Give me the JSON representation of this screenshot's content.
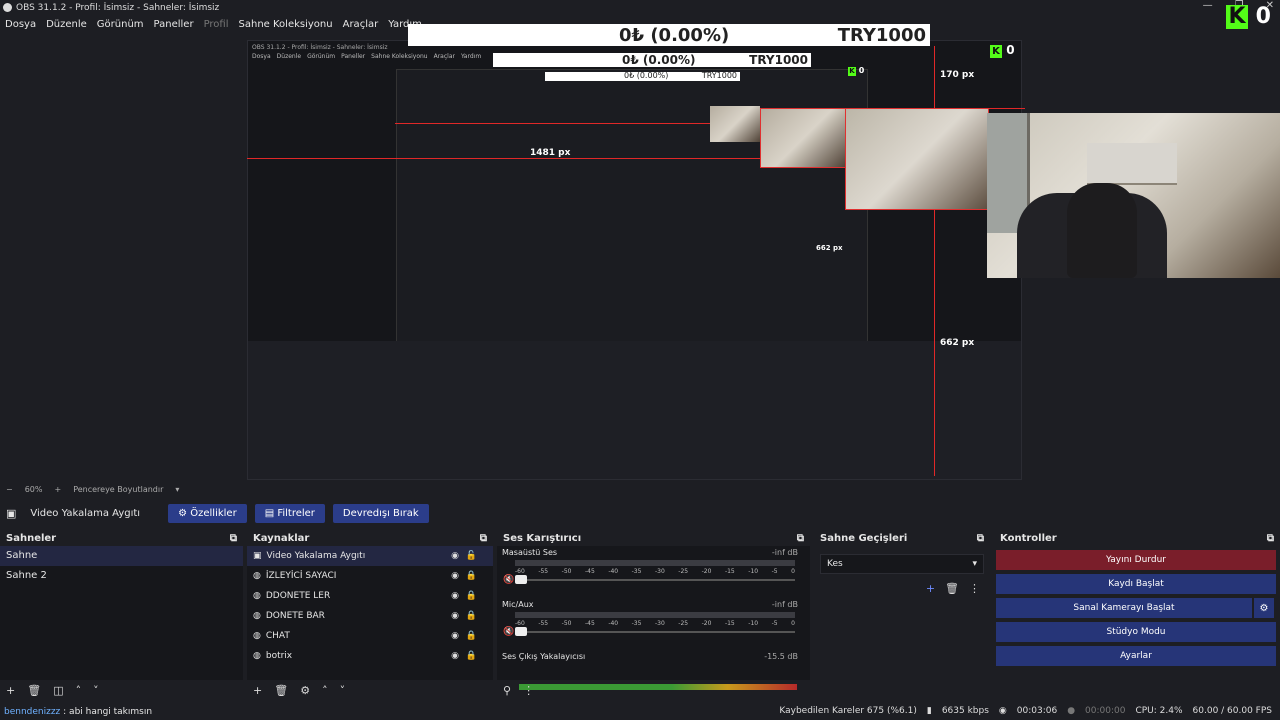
{
  "window": {
    "title": "OBS 31.1.2 - Profil: İsimsiz - Sahneler: İsimsiz",
    "controls": [
      "—",
      "❐",
      "✕"
    ]
  },
  "menu": [
    "Dosya",
    "Düzenle",
    "Görünüm",
    "Paneller",
    "Profil",
    "Sahne Koleksiyonu",
    "Araçlar",
    "Yardım"
  ],
  "overlay": {
    "ticker_left": "0₺ (0.00%)",
    "ticker_right": "TRY1000",
    "kick_count": "0",
    "px_labels": [
      "170 px",
      "1481 px",
      "662 px",
      "662 px"
    ]
  },
  "zoom": {
    "value": "60%",
    "fit_label": "Pencereye Boyutlandır"
  },
  "source_toolbar": {
    "current_source": "Video Yakalama Aygıtı",
    "properties": "Özellikler",
    "filters": "Filtreler",
    "deactivate": "Devredışı Bırak"
  },
  "scenes": {
    "title": "Sahneler",
    "items": [
      "Sahne",
      "Sahne 2"
    ]
  },
  "sources": {
    "title": "Kaynaklar",
    "items": [
      "Video Yakalama Aygıtı",
      "İZLEYİCİ SAYACI",
      "DDONETE LER",
      "DONETE BAR",
      "CHAT",
      "botrix"
    ]
  },
  "mixer": {
    "title": "Ses Karıştırıcı",
    "channels": [
      {
        "name": "Masaüstü Ses",
        "db": "-inf dB"
      },
      {
        "name": "Mic/Aux",
        "db": "-inf dB"
      }
    ],
    "scale": [
      "-60",
      "-55",
      "-50",
      "-45",
      "-40",
      "-35",
      "-30",
      "-25",
      "-20",
      "-15",
      "-10",
      "-5",
      "0"
    ],
    "output": {
      "name": "Ses Çıkış Yakalayıcısı",
      "db": "-15.5 dB"
    }
  },
  "transitions": {
    "title": "Sahne Geçişleri",
    "selected": "Kes"
  },
  "controls": {
    "title": "Kontroller",
    "stop_stream": "Yayını Durdur",
    "start_recording": "Kaydı Başlat",
    "virtual_camera": "Sanal Kamerayı Başlat",
    "studio_mode": "Stüdyo Modu",
    "settings": "Ayarlar"
  },
  "status": {
    "chat_user": "benndenizzz",
    "chat_message": " : abi hangi takımsın",
    "dropped_frames": "Kaybedilen Kareler 675 (%6.1)",
    "bitrate": "6635 kbps",
    "stream_time": "00:03:06",
    "rec_time": "00:00:00",
    "cpu": "CPU: 2.4%",
    "fps": "60.00 / 60.00 FPS"
  },
  "colors": {
    "bg": "#1d1e23",
    "button_blue": "#263578",
    "stop_red": "#7a1e2a",
    "guide_red": "#e02828",
    "kick_green": "#53fc18"
  }
}
